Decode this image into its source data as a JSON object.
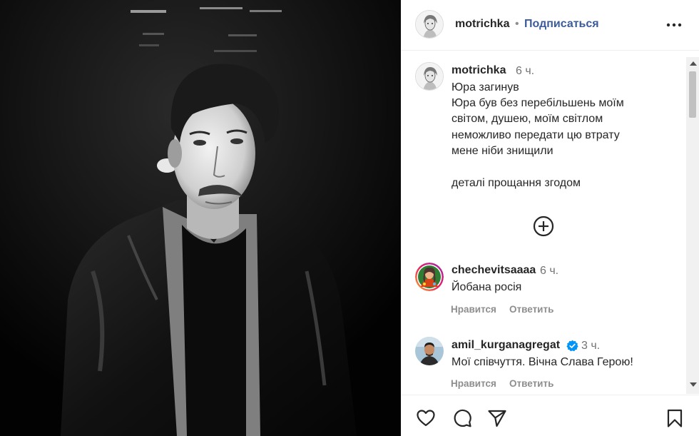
{
  "post": {
    "username": "motrichka",
    "separator": "•",
    "follow_label": "Подписаться",
    "more_icon": "more-horizontal-icon"
  },
  "caption": {
    "username": "motrichka",
    "time": "6 ч.",
    "lines": [
      "Юра загинув",
      "Юра був без перебільшень моїм",
      "світом, душею, моїм світлом",
      "неможливо передати цю втрату",
      "мене ніби знищили",
      "деталі прощання згодом"
    ]
  },
  "load_more_icon": "plus-circle-icon",
  "comments": [
    {
      "username": "chechevitsaaaa",
      "time": "6 ч.",
      "text": "Йобана росія",
      "like_label": "Нравится",
      "reply_label": "Ответить"
    },
    {
      "username": "amil_kurganagregat",
      "verified": true,
      "time": "3 ч.",
      "text": "Мої співчуття. Вічна Слава Герою!",
      "like_label": "Нравится",
      "reply_label": "Ответить"
    }
  ],
  "actions": {
    "like_icon": "heart-icon",
    "comment_icon": "comment-icon",
    "share_icon": "send-icon",
    "save_icon": "bookmark-icon"
  },
  "colors": {
    "follow": "#3b5b9c",
    "verified": "#0095f6",
    "muted": "#8e8e8e"
  }
}
